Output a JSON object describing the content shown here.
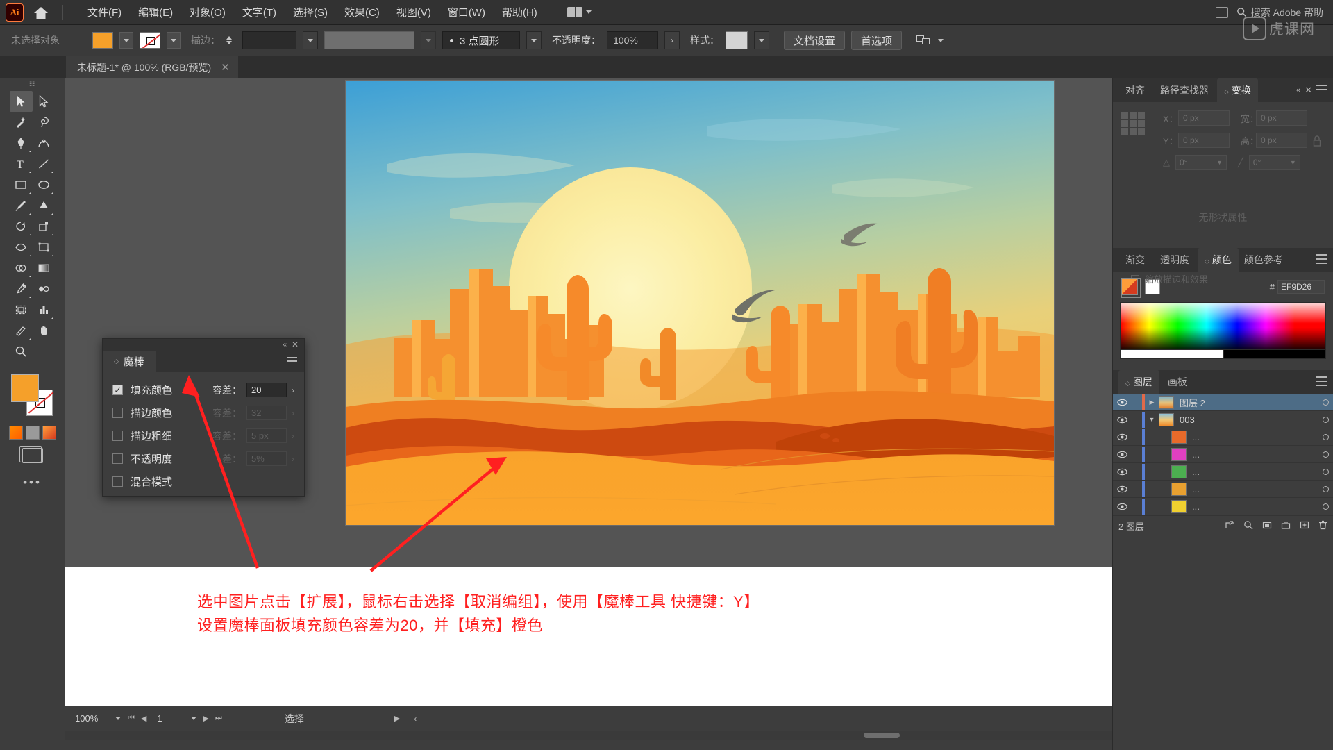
{
  "app": {
    "logo": "Ai",
    "title_tab": "未标题-1* @ 100% (RGB/预览)"
  },
  "menubar": {
    "items": [
      "文件(F)",
      "编辑(E)",
      "对象(O)",
      "文字(T)",
      "选择(S)",
      "效果(C)",
      "视图(V)",
      "窗口(W)",
      "帮助(H)"
    ],
    "search_placeholder": "搜索 Adobe 帮助"
  },
  "controlbar": {
    "selection_status": "未选择对象",
    "fill_color": "#F5A02A",
    "stroke_label": "描边：",
    "stroke_weight": "",
    "brush_profile": "3 点圆形",
    "opacity_label": "不透明度：",
    "opacity_value": "100%",
    "style_label": "样式：",
    "document_setup": "文档设置",
    "preferences": "首选项"
  },
  "toolbar": {
    "tools": [
      "selection-tool",
      "direct-selection-tool",
      "magic-wand-tool",
      "lasso-tool",
      "pen-tool",
      "curvature-tool",
      "type-tool",
      "line-segment-tool",
      "rectangle-tool",
      "ellipse-tool",
      "paintbrush-tool",
      "shaper-tool",
      "rotate-tool",
      "scale-tool",
      "width-tool",
      "free-transform-tool",
      "shape-builder-tool",
      "gradient-tool",
      "eyedropper-tool",
      "blend-tool",
      "artboard-tool",
      "graph-tool",
      "slice-tool",
      "hand-tool",
      "zoom-tool",
      "perspective-grid-tool"
    ],
    "more_tools": "•••"
  },
  "magic_wand_panel": {
    "tab_label": "魔棒",
    "rows": [
      {
        "label": "填充颜色",
        "checked": true,
        "tol_label": "容差：",
        "tol_value": "20",
        "enabled": true
      },
      {
        "label": "描边颜色",
        "checked": false,
        "tol_label": "容差：",
        "tol_value": "32",
        "enabled": false
      },
      {
        "label": "描边粗细",
        "checked": false,
        "tol_label": "容差：",
        "tol_value": "5 px",
        "enabled": false
      },
      {
        "label": "不透明度",
        "checked": false,
        "tol_label": "差：",
        "tol_value": "5%",
        "enabled": false
      },
      {
        "label": "混合模式",
        "checked": false,
        "tol_label": "",
        "tol_value": "",
        "enabled": false
      }
    ]
  },
  "right_dock": {
    "group1_tabs": [
      "对齐",
      "路径查找器",
      "变换"
    ],
    "group1_active": "变换",
    "transform": {
      "x_label": "X：",
      "x_value": "0 px",
      "y_label": "Y：",
      "y_value": "0 px",
      "w_label": "宽：",
      "w_value": "0 px",
      "h_label": "高：",
      "h_value": "0 px",
      "angle_value": "0°",
      "shear_value": "0°",
      "no_props": "无形状属性",
      "check1": "缩放圆角",
      "check2": "缩放描边和效果"
    },
    "group2_tabs": [
      "渐变",
      "透明度",
      "颜色",
      "颜色参考"
    ],
    "group2_active": "颜色",
    "color": {
      "hex_prefix": "#",
      "hex_value": "EF9D26"
    },
    "group3_tabs": [
      "图层",
      "画板"
    ],
    "group3_active": "图层",
    "layers": [
      {
        "name": "图层 2",
        "selected": true,
        "expanded": false,
        "has_thumb": true,
        "thumb": "#c98a4a",
        "bar": "#e06a4a",
        "indent": 0
      },
      {
        "name": "003",
        "selected": false,
        "expanded": true,
        "has_thumb": true,
        "thumb": "#e08030",
        "bar": "#5a7fd4",
        "indent": 0
      },
      {
        "name": "...",
        "selected": false,
        "expanded": false,
        "has_thumb": true,
        "thumb": "#e86a2a",
        "bar": "#5a7fd4",
        "indent": 1
      },
      {
        "name": "...",
        "selected": false,
        "expanded": false,
        "has_thumb": true,
        "thumb": "#e040c0",
        "bar": "#5a7fd4",
        "indent": 1
      },
      {
        "name": "...",
        "selected": false,
        "expanded": false,
        "has_thumb": true,
        "thumb": "#4caf50",
        "bar": "#5a7fd4",
        "indent": 1
      },
      {
        "name": "...",
        "selected": false,
        "expanded": false,
        "has_thumb": true,
        "thumb": "#e8a030",
        "bar": "#5a7fd4",
        "indent": 1
      },
      {
        "name": "...",
        "selected": false,
        "expanded": false,
        "has_thumb": true,
        "thumb": "#f0d030",
        "bar": "#5a7fd4",
        "indent": 1
      }
    ],
    "layers_footer_count": "2 图层"
  },
  "statusbar": {
    "zoom": "100%",
    "page": "1",
    "tool_status": "选择"
  },
  "caption": {
    "line1": "选中图片点击【扩展】，鼠标右击选择【取消编组】，使用【魔棒工具 快捷键：Y】",
    "line2": "设置魔棒面板填充颜色容差为20，并【填充】橙色"
  },
  "watermark": {
    "text": "虎课网"
  },
  "colors": {
    "accent_orange": "#EF9D26",
    "arrow_red": "#FF2020",
    "panel_bg": "#3D3D3D",
    "chrome_bg": "#323232",
    "canvas_bg": "#545454",
    "layer_selected": "#4D6C86"
  }
}
